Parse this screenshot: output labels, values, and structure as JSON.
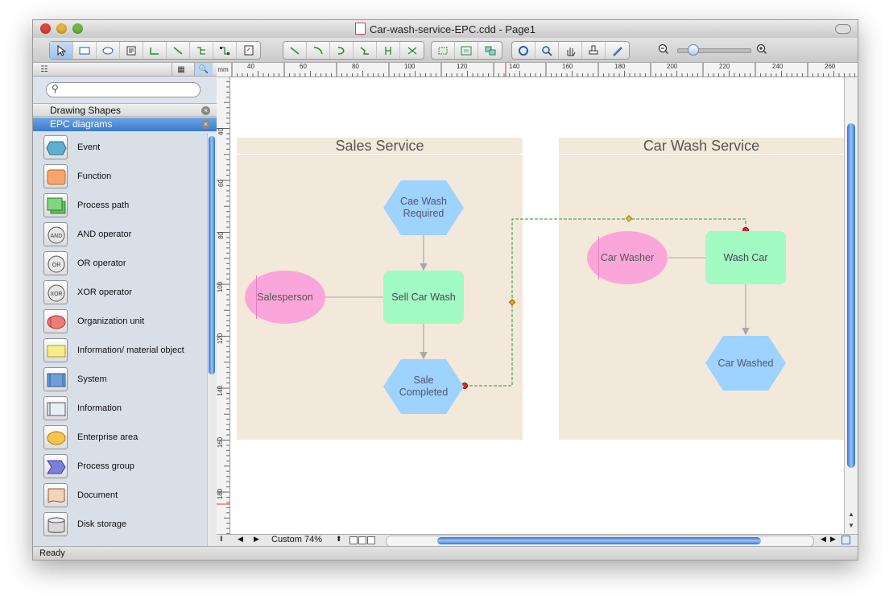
{
  "window": {
    "title": "Car-wash-service-EPC.cdd - Page1"
  },
  "toolbar": {
    "tools": [
      "pointer-icon",
      "rectangle-icon",
      "ellipse-icon",
      "text-icon",
      "connector-icon",
      "line-icon",
      "tree-icon",
      "layout-icon",
      "insert-icon"
    ],
    "connectors": [
      "direct-connector-icon",
      "arc-connector-icon",
      "curve-connector-icon",
      "smart-connector-icon",
      "split-icon",
      "join-icon"
    ],
    "arrange": [
      "snap-icon",
      "group-icon",
      "ungroup-icon"
    ],
    "view": [
      "rotate-icon",
      "zoom-icon",
      "pan-icon",
      "stamp-icon",
      "pen-icon"
    ]
  },
  "sidebar": {
    "search_placeholder": "",
    "libraries": [
      {
        "label": "Drawing Shapes",
        "active": false
      },
      {
        "label": "EPC diagrams",
        "active": true
      }
    ],
    "shapes": [
      {
        "label": "Event",
        "icon": "event-shape-icon"
      },
      {
        "label": "Function",
        "icon": "function-shape-icon"
      },
      {
        "label": "Process path",
        "icon": "process-path-shape-icon"
      },
      {
        "label": "AND operator",
        "icon": "and-operator-shape-icon",
        "glyph": "AND"
      },
      {
        "label": "OR operator",
        "icon": "or-operator-shape-icon",
        "glyph": "OR"
      },
      {
        "label": "XOR operator",
        "icon": "xor-operator-shape-icon",
        "glyph": "XOR"
      },
      {
        "label": "Organization unit",
        "icon": "organization-unit-shape-icon"
      },
      {
        "label": "Information/ material object",
        "icon": "information-object-shape-icon"
      },
      {
        "label": "System",
        "icon": "system-shape-icon"
      },
      {
        "label": "Information",
        "icon": "information-shape-icon"
      },
      {
        "label": "Enterprise area",
        "icon": "enterprise-area-shape-icon"
      },
      {
        "label": "Process group",
        "icon": "process-group-shape-icon"
      },
      {
        "label": "Document",
        "icon": "document-shape-icon"
      },
      {
        "label": "Disk storage",
        "icon": "disk-storage-shape-icon"
      }
    ]
  },
  "rulers": {
    "unit": "mm",
    "top_labels": [
      "40",
      "60",
      "80",
      "100",
      "120",
      "140",
      "160",
      "180",
      "200",
      "220",
      "240",
      "260"
    ],
    "left_labels": [
      "40",
      "60",
      "80",
      "100",
      "120",
      "140",
      "160",
      "180"
    ]
  },
  "diagram": {
    "pools": [
      {
        "title": "Sales Service"
      },
      {
        "title": "Car Wash Service"
      }
    ],
    "nodes": {
      "cae_wash_required": "Cae Wash Required",
      "sell_car_wash": "Sell Car Wash",
      "salesperson": "Salesperson",
      "sale_completed": "Sale Completed",
      "car_washer": "Car Washer",
      "wash_car": "Wash Car",
      "car_washed": "Car Washed"
    },
    "colors": {
      "event": "#9ed2ff",
      "function": "#a2fbc2",
      "org_unit": "#fba6da",
      "pool": "#f3e9da",
      "cross_link": "#2a9a36"
    }
  },
  "bottom": {
    "zoom_label": "Custom 74%"
  },
  "status": {
    "text": "Ready"
  }
}
